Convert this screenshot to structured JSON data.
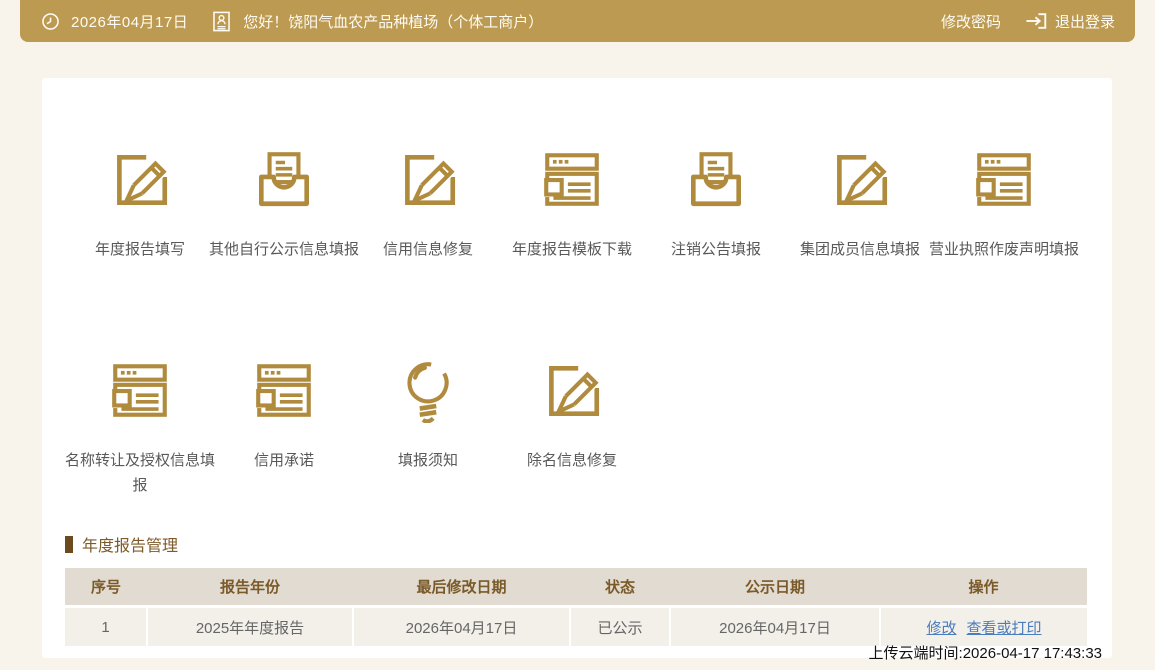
{
  "topbar": {
    "date": "2026年04月17日",
    "greeting": "您好！饶阳气血农产品种植场（个体工商户）",
    "change_password": "修改密码",
    "logout": "退出登录"
  },
  "menu": {
    "rows": [
      [
        {
          "label": "年度报告填写",
          "icon": "edit-pencil-icon"
        },
        {
          "label": "其他自行公示信息填报",
          "icon": "inbox-document-icon"
        },
        {
          "label": "信用信息修复",
          "icon": "edit-pencil-icon"
        },
        {
          "label": "年度报告模板下载",
          "icon": "webpage-form-icon"
        },
        {
          "label": "注销公告填报",
          "icon": "inbox-document-icon"
        },
        {
          "label": "集团成员信息填报",
          "icon": "edit-pencil-icon"
        },
        {
          "label": "营业执照作废声明填报",
          "icon": "webpage-form-icon"
        }
      ],
      [
        {
          "label": "名称转让及授权信息填报",
          "icon": "webpage-form-icon"
        },
        {
          "label": "信用承诺",
          "icon": "webpage-form-icon"
        },
        {
          "label": "填报须知",
          "icon": "lightbulb-icon"
        },
        {
          "label": "除名信息修复",
          "icon": "edit-pencil-icon"
        }
      ]
    ]
  },
  "annual_report_section": {
    "title": "年度报告管理",
    "table": {
      "headers": [
        "序号",
        "报告年份",
        "最后修改日期",
        "状态",
        "公示日期",
        "操作"
      ],
      "rows": [
        {
          "seq": "1",
          "report_year": "2025年年度报告",
          "last_modified": "2026年04月17日",
          "status": "已公示",
          "publish_date": "2026年04月17日",
          "action_edit": "修改",
          "action_view_print": "查看或打印"
        }
      ]
    }
  },
  "footer": {
    "upload_time": "上传云端时间:2026-04-17 17:43:33"
  },
  "colors": {
    "topbar_bg": "#bd9a52",
    "icon_gold": "#b08b3e",
    "page_bg": "#f8f4eb",
    "section_title": "#7d5a28",
    "table_header_bg": "#e2dbd1",
    "table_row_bg": "#f3f0ea",
    "link_blue": "#4a7dbe"
  }
}
